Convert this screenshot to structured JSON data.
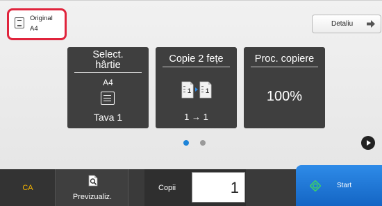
{
  "original": {
    "label": "Original",
    "size": "A4"
  },
  "details_button": {
    "label": "Detaliu"
  },
  "tiles": {
    "paper": {
      "title_line1": "Select.",
      "title_line2": "hârtie",
      "size": "A4",
      "tray": "Tava 1"
    },
    "duplex": {
      "title": "Copie 2 fețe",
      "mode": "1 → 1"
    },
    "ratio": {
      "title": "Proc. copiere",
      "value": "100%"
    }
  },
  "pager": {
    "total": 2,
    "active": 1
  },
  "bottom": {
    "ca_label": "CA",
    "preview_label": "Previzualiz.",
    "copies_label": "Copii",
    "copies_value": "1",
    "start_label": "Start"
  },
  "colors": {
    "highlight": "#e0243c",
    "ca_text": "#f5b400",
    "start": "#1e78d8",
    "active_dot": "#1e84d8",
    "start_icon": "#3ccf6a"
  }
}
